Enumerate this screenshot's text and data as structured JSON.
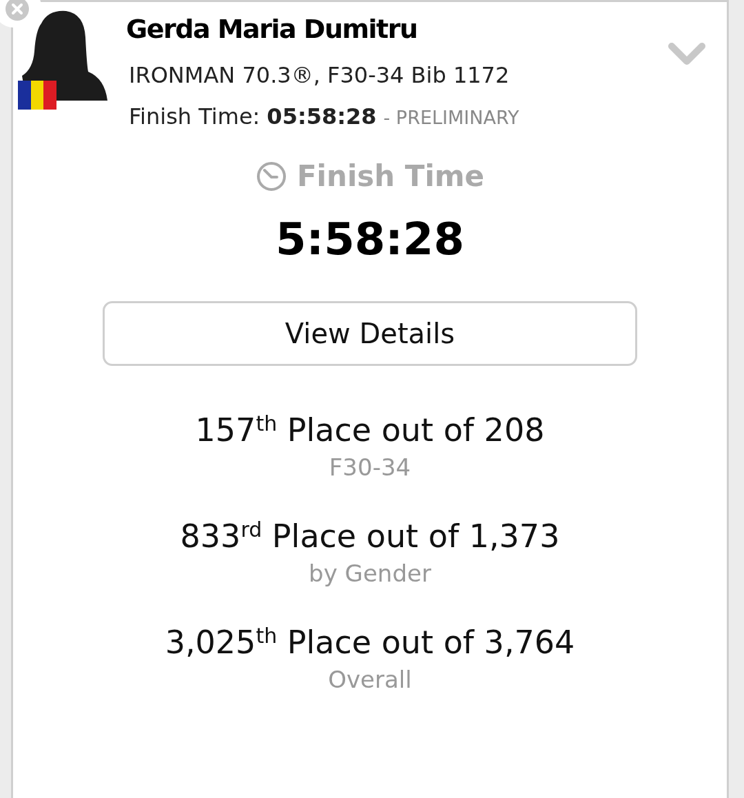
{
  "athlete": {
    "name": "Gerda Maria Dumitru",
    "race_line": "IRONMAN 70.3®, F30-34 Bib 1172",
    "finish_label": "Finish Time:",
    "finish_value": "05:58:28",
    "finish_status": "- PRELIMINARY"
  },
  "summary": {
    "heading": "Finish Time",
    "time": "5:58:28",
    "button": "View Details"
  },
  "placements": [
    {
      "text": "157$^{th}$ Place out of 208",
      "caption": "F30-34"
    },
    {
      "text": "833$^{rd}$ Place out of 1,373",
      "caption": "by Gender"
    },
    {
      "text": "3,025$^{th}$ Place out of 3,764",
      "caption": "Overall"
    }
  ]
}
